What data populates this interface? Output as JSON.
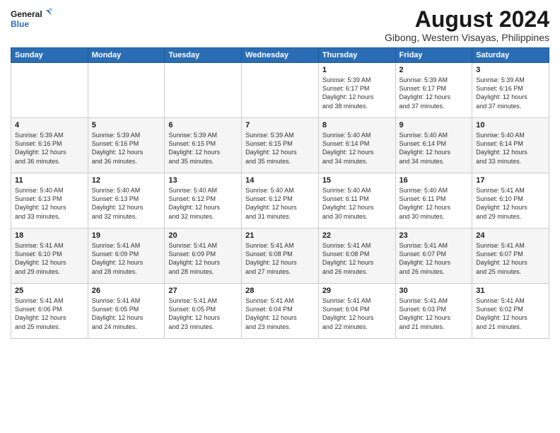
{
  "logo": {
    "line1": "General",
    "line2": "Blue"
  },
  "title": "August 2024",
  "subtitle": "Gibong, Western Visayas, Philippines",
  "days_header": [
    "Sunday",
    "Monday",
    "Tuesday",
    "Wednesday",
    "Thursday",
    "Friday",
    "Saturday"
  ],
  "weeks": [
    [
      {
        "num": "",
        "info": ""
      },
      {
        "num": "",
        "info": ""
      },
      {
        "num": "",
        "info": ""
      },
      {
        "num": "",
        "info": ""
      },
      {
        "num": "1",
        "info": "Sunrise: 5:39 AM\nSunset: 6:17 PM\nDaylight: 12 hours\nand 38 minutes."
      },
      {
        "num": "2",
        "info": "Sunrise: 5:39 AM\nSunset: 6:17 PM\nDaylight: 12 hours\nand 37 minutes."
      },
      {
        "num": "3",
        "info": "Sunrise: 5:39 AM\nSunset: 6:16 PM\nDaylight: 12 hours\nand 37 minutes."
      }
    ],
    [
      {
        "num": "4",
        "info": "Sunrise: 5:39 AM\nSunset: 6:16 PM\nDaylight: 12 hours\nand 36 minutes."
      },
      {
        "num": "5",
        "info": "Sunrise: 5:39 AM\nSunset: 6:16 PM\nDaylight: 12 hours\nand 36 minutes."
      },
      {
        "num": "6",
        "info": "Sunrise: 5:39 AM\nSunset: 6:15 PM\nDaylight: 12 hours\nand 35 minutes."
      },
      {
        "num": "7",
        "info": "Sunrise: 5:39 AM\nSunset: 6:15 PM\nDaylight: 12 hours\nand 35 minutes."
      },
      {
        "num": "8",
        "info": "Sunrise: 5:40 AM\nSunset: 6:14 PM\nDaylight: 12 hours\nand 34 minutes."
      },
      {
        "num": "9",
        "info": "Sunrise: 5:40 AM\nSunset: 6:14 PM\nDaylight: 12 hours\nand 34 minutes."
      },
      {
        "num": "10",
        "info": "Sunrise: 5:40 AM\nSunset: 6:14 PM\nDaylight: 12 hours\nand 33 minutes."
      }
    ],
    [
      {
        "num": "11",
        "info": "Sunrise: 5:40 AM\nSunset: 6:13 PM\nDaylight: 12 hours\nand 33 minutes."
      },
      {
        "num": "12",
        "info": "Sunrise: 5:40 AM\nSunset: 6:13 PM\nDaylight: 12 hours\nand 32 minutes."
      },
      {
        "num": "13",
        "info": "Sunrise: 5:40 AM\nSunset: 6:12 PM\nDaylight: 12 hours\nand 32 minutes."
      },
      {
        "num": "14",
        "info": "Sunrise: 5:40 AM\nSunset: 6:12 PM\nDaylight: 12 hours\nand 31 minutes."
      },
      {
        "num": "15",
        "info": "Sunrise: 5:40 AM\nSunset: 6:11 PM\nDaylight: 12 hours\nand 30 minutes."
      },
      {
        "num": "16",
        "info": "Sunrise: 5:40 AM\nSunset: 6:11 PM\nDaylight: 12 hours\nand 30 minutes."
      },
      {
        "num": "17",
        "info": "Sunrise: 5:41 AM\nSunset: 6:10 PM\nDaylight: 12 hours\nand 29 minutes."
      }
    ],
    [
      {
        "num": "18",
        "info": "Sunrise: 5:41 AM\nSunset: 6:10 PM\nDaylight: 12 hours\nand 29 minutes."
      },
      {
        "num": "19",
        "info": "Sunrise: 5:41 AM\nSunset: 6:09 PM\nDaylight: 12 hours\nand 28 minutes."
      },
      {
        "num": "20",
        "info": "Sunrise: 5:41 AM\nSunset: 6:09 PM\nDaylight: 12 hours\nand 28 minutes."
      },
      {
        "num": "21",
        "info": "Sunrise: 5:41 AM\nSunset: 6:08 PM\nDaylight: 12 hours\nand 27 minutes."
      },
      {
        "num": "22",
        "info": "Sunrise: 5:41 AM\nSunset: 6:08 PM\nDaylight: 12 hours\nand 26 minutes."
      },
      {
        "num": "23",
        "info": "Sunrise: 5:41 AM\nSunset: 6:07 PM\nDaylight: 12 hours\nand 26 minutes."
      },
      {
        "num": "24",
        "info": "Sunrise: 5:41 AM\nSunset: 6:07 PM\nDaylight: 12 hours\nand 25 minutes."
      }
    ],
    [
      {
        "num": "25",
        "info": "Sunrise: 5:41 AM\nSunset: 6:06 PM\nDaylight: 12 hours\nand 25 minutes."
      },
      {
        "num": "26",
        "info": "Sunrise: 5:41 AM\nSunset: 6:05 PM\nDaylight: 12 hours\nand 24 minutes."
      },
      {
        "num": "27",
        "info": "Sunrise: 5:41 AM\nSunset: 6:05 PM\nDaylight: 12 hours\nand 23 minutes."
      },
      {
        "num": "28",
        "info": "Sunrise: 5:41 AM\nSunset: 6:04 PM\nDaylight: 12 hours\nand 23 minutes."
      },
      {
        "num": "29",
        "info": "Sunrise: 5:41 AM\nSunset: 6:04 PM\nDaylight: 12 hours\nand 22 minutes."
      },
      {
        "num": "30",
        "info": "Sunrise: 5:41 AM\nSunset: 6:03 PM\nDaylight: 12 hours\nand 21 minutes."
      },
      {
        "num": "31",
        "info": "Sunrise: 5:41 AM\nSunset: 6:02 PM\nDaylight: 12 hours\nand 21 minutes."
      }
    ]
  ]
}
